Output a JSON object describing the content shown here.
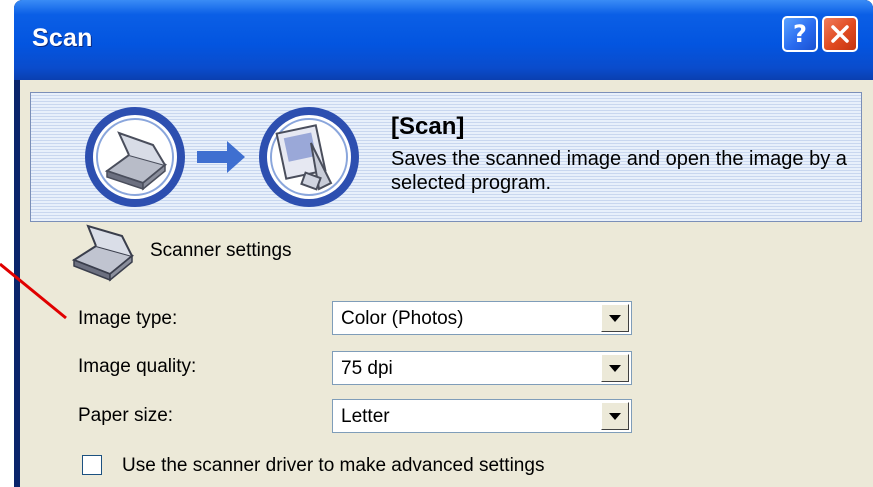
{
  "window": {
    "title": "Scan"
  },
  "titlebar": {
    "help_glyph": "?",
    "close_icon": "close-icon"
  },
  "banner": {
    "title": "[Scan]",
    "description": "Saves the scanned image and open the image by a selected program."
  },
  "section": {
    "label": "Scanner settings"
  },
  "settings": {
    "image_type": {
      "label": "Image type:",
      "value": "Color (Photos)"
    },
    "image_quality": {
      "label": "Image quality:",
      "value": "75 dpi"
    },
    "paper_size": {
      "label": "Paper size:",
      "value": "Letter"
    }
  },
  "advanced": {
    "label": "Use the scanner driver to make advanced settings",
    "checked": false
  },
  "colors": {
    "titlebar": "#0355e0",
    "face": "#ece9d8",
    "pointer": "#e00000"
  }
}
